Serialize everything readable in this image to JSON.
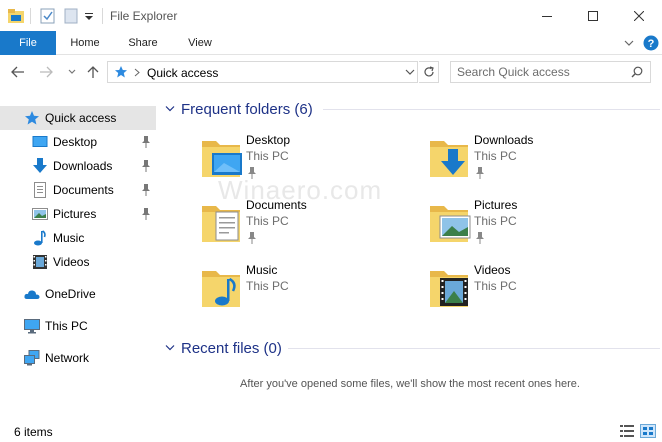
{
  "window": {
    "title": "File Explorer",
    "accent_color": "#1979ca",
    "folder_color": "#f5d56b"
  },
  "quick_access_toolbar": {
    "icons": [
      "folder-icon",
      "properties-icon",
      "new-folder-icon",
      "customize-dropdown-icon"
    ]
  },
  "window_controls": [
    "minimize-icon",
    "maximize-icon",
    "close-icon"
  ],
  "ribbon": {
    "tabs": [
      {
        "label": "File",
        "active": true
      },
      {
        "label": "Home"
      },
      {
        "label": "Share"
      },
      {
        "label": "View"
      }
    ],
    "right_icons": [
      "expand-ribbon-icon",
      "help-icon"
    ]
  },
  "address": {
    "breadcrumb": "Quick access",
    "nav_icons": [
      "back-icon",
      "forward-icon",
      "recent-locations-icon",
      "up-icon"
    ],
    "search_placeholder": "Search Quick access"
  },
  "nav_pane": {
    "items": [
      {
        "label": "Quick access",
        "icon": "star-icon",
        "selected": true
      },
      {
        "label": "Desktop",
        "icon": "desktop-icon",
        "pinned": true
      },
      {
        "label": "Downloads",
        "icon": "download-icon",
        "pinned": true
      },
      {
        "label": "Documents",
        "icon": "document-icon",
        "pinned": true
      },
      {
        "label": "Pictures",
        "icon": "pictures-icon",
        "pinned": true
      },
      {
        "label": "Music",
        "icon": "music-icon"
      },
      {
        "label": "Videos",
        "icon": "video-icon"
      },
      {
        "label": "OneDrive",
        "icon": "cloud-icon"
      },
      {
        "label": "This PC",
        "icon": "computer-icon"
      },
      {
        "label": "Network",
        "icon": "network-icon"
      }
    ]
  },
  "frequent": {
    "title": "Frequent folders (6)",
    "folders": [
      {
        "name": "Desktop",
        "location": "This PC",
        "icon": "desktop-folder-icon",
        "pinned": true
      },
      {
        "name": "Downloads",
        "location": "This PC",
        "icon": "downloads-folder-icon",
        "pinned": true
      },
      {
        "name": "Documents",
        "location": "This PC",
        "icon": "documents-folder-icon",
        "pinned": true
      },
      {
        "name": "Pictures",
        "location": "This PC",
        "icon": "pictures-folder-icon",
        "pinned": true
      },
      {
        "name": "Music",
        "location": "This PC",
        "icon": "music-folder-icon"
      },
      {
        "name": "Videos",
        "location": "This PC",
        "icon": "videos-folder-icon"
      }
    ]
  },
  "recent": {
    "title": "Recent files (0)",
    "empty_message": "After you've opened some files, we'll show the most recent ones here."
  },
  "watermark": "Winaero.com",
  "status": {
    "item_count": "6 items"
  }
}
